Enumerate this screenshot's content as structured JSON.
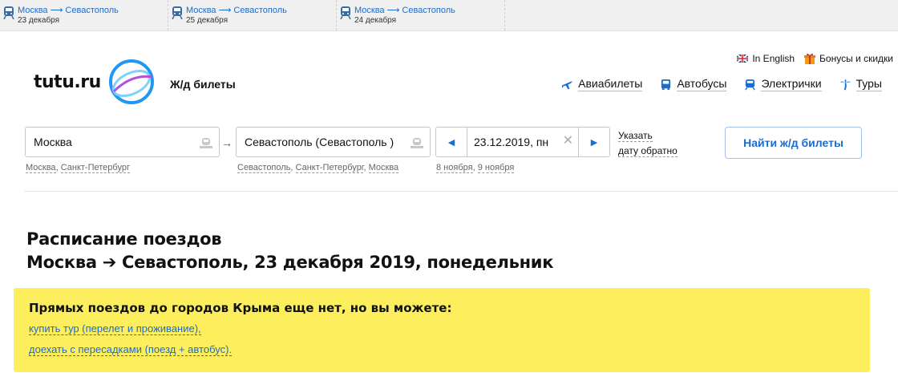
{
  "recent_searches": [
    {
      "route": "Москва ⟶ Севастополь",
      "date": "23 декабря"
    },
    {
      "route": "Москва ⟶ Севастополь",
      "date": "25 декабря"
    },
    {
      "route": "Москва ⟶ Севастополь",
      "date": "24 декабря"
    }
  ],
  "header": {
    "logo_text": "tutu.ru",
    "section_title": "Ж/д билеты",
    "top_links": {
      "english": "In English",
      "bonuses": "Бонусы и скидки"
    },
    "nav": {
      "flights": "Авиабилеты",
      "buses": "Автобусы",
      "commuter": "Электрички",
      "tours": "Туры"
    }
  },
  "search": {
    "from_value": "Москва",
    "from_hint_1": "Москва",
    "from_hint_2": "Санкт-Петербург",
    "to_value": "Севастополь (Севастополь )",
    "to_hint_1": "Севастополь",
    "to_hint_2": "Санкт-Петербург",
    "to_hint_3": "Москва",
    "date_value": "23.12.2019, пн",
    "date_hint_1": "8 ноября",
    "date_hint_2": "9 ноября",
    "return_line_1": "Указать",
    "return_line_2": "дату обратно",
    "submit_label": "Найти ж/д билеты"
  },
  "page": {
    "title_line_1": "Расписание поездов",
    "title_line_2": "Москва ➔ Севастополь, 23 декабря 2019, понедельник"
  },
  "notice": {
    "title": "Прямых поездов до городов Крыма еще нет, но вы можете:",
    "link_tour": "купить тур (перелет и проживание),",
    "link_transfer": "доехать с пересадками (поезд + автобус)."
  },
  "colors": {
    "accent": "#1a6ccf",
    "notice_bg": "#fcee5c",
    "logo_ring": "#2196f3"
  }
}
